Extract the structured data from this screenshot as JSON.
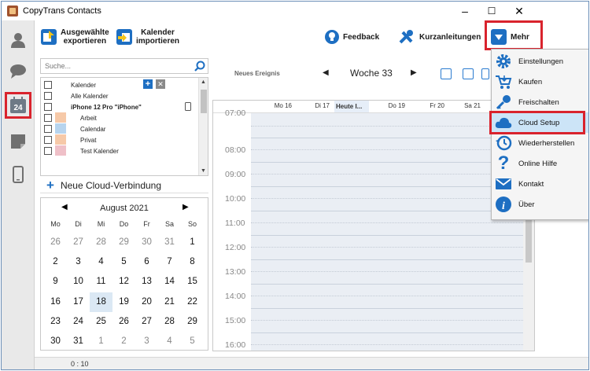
{
  "window": {
    "title": "CopyTrans Contacts",
    "minimize": "–",
    "maximize": "☐",
    "close": "✕"
  },
  "sidebar": {
    "items": [
      {
        "name": "contacts",
        "icon": "person-icon"
      },
      {
        "name": "messages",
        "icon": "chat-bubble-icon"
      },
      {
        "name": "calendar",
        "icon": "calendar-icon",
        "badge": "24",
        "active": true
      },
      {
        "name": "notes",
        "icon": "note-icon"
      },
      {
        "name": "device",
        "icon": "phone-icon"
      }
    ]
  },
  "toolbar": {
    "export_label_1": "Ausgewählte",
    "export_label_2": "exportieren",
    "import_label_1": "Kalender",
    "import_label_2": "importieren",
    "feedback_label": "Feedback",
    "guides_label": "Kurzanleitungen",
    "more_label": "Mehr"
  },
  "search": {
    "placeholder": "Suche..."
  },
  "calendar_list": {
    "header": "Kalender",
    "all_calendars": "Alle Kalender",
    "device": "iPhone 12 Pro \"iPhone\"",
    "calendars": [
      {
        "name": "Arbeit",
        "color": "#f6c9a8"
      },
      {
        "name": "Calendar",
        "color": "#b7d4ee"
      },
      {
        "name": "Privat",
        "color": "#f6c9a8"
      },
      {
        "name": "Test Kalender",
        "color": "#efc0c8"
      }
    ]
  },
  "new_cloud": {
    "label": "Neue Cloud-Verbindung"
  },
  "month_calendar": {
    "title": "August 2021",
    "prev": "◀",
    "next": "▶",
    "weekdays": [
      "Mo",
      "Di",
      "Mi",
      "Do",
      "Fr",
      "Sa",
      "So"
    ],
    "weeks": [
      [
        "26",
        "27",
        "28",
        "29",
        "30",
        "31",
        "1"
      ],
      [
        "2",
        "3",
        "4",
        "5",
        "6",
        "7",
        "8"
      ],
      [
        "9",
        "10",
        "11",
        "12",
        "13",
        "14",
        "15"
      ],
      [
        "16",
        "17",
        "18",
        "19",
        "20",
        "21",
        "22"
      ],
      [
        "23",
        "24",
        "25",
        "26",
        "27",
        "28",
        "29"
      ],
      [
        "30",
        "31",
        "1",
        "2",
        "3",
        "4",
        "5"
      ]
    ]
  },
  "week_view": {
    "new_event": "Neues Ereignis",
    "week_label": "Woche 33",
    "prev": "◀",
    "next": "▶",
    "days": [
      "Mo 16",
      "Di 17",
      "Heute I...",
      "Do 19",
      "Fr 20",
      "Sa 21"
    ],
    "times": [
      "07:00",
      "08:00",
      "09:00",
      "10:00",
      "11:00",
      "12:00",
      "13:00",
      "14:00",
      "15:00",
      "16:00"
    ]
  },
  "more_menu": {
    "items": [
      {
        "label": "Einstellungen",
        "icon": "gear-icon"
      },
      {
        "label": "Kaufen",
        "icon": "cart-icon"
      },
      {
        "label": "Freischalten",
        "icon": "key-icon"
      },
      {
        "label": "Cloud Setup",
        "icon": "cloud-icon",
        "selected": true
      },
      {
        "label": "Wiederherstellen",
        "icon": "restore-clock-icon"
      },
      {
        "label": "Online Hilfe",
        "icon": "question-icon"
      },
      {
        "label": "Kontakt",
        "icon": "envelope-icon"
      },
      {
        "label": "Über",
        "icon": "info-icon"
      }
    ]
  },
  "status": {
    "counter": "0 : 10"
  },
  "colors": {
    "accent": "#1e6fc2",
    "highlight": "#d9232d",
    "selected_menu": "#cce4f7"
  }
}
